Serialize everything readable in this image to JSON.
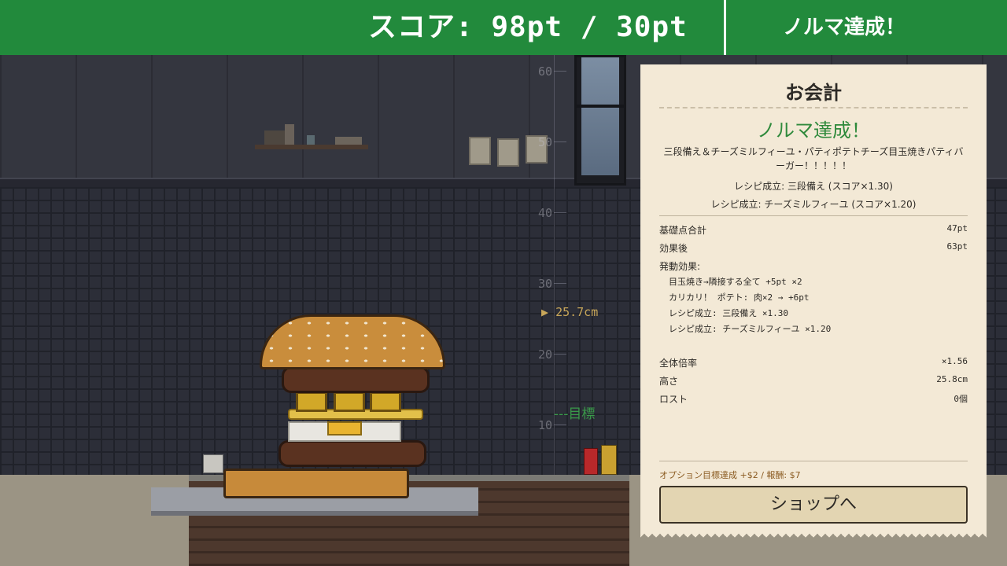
{
  "header": {
    "score_text": "スコア: 98pt / 30pt",
    "quota_status": "ノルマ達成！"
  },
  "scene": {
    "ruler_ticks": [
      "60",
      "50",
      "40",
      "30",
      "20",
      "10"
    ],
    "current_height": "25.7cm",
    "target_label": "目標"
  },
  "receipt": {
    "title": "お会計",
    "quota_status": "ノルマ達成！",
    "burger_name": "三段備え＆チーズミルフィーユ・パティポテトチーズ目玉焼きパティバーガー！！！！！",
    "recipes": [
      "レシピ成立: 三段備え (スコア×1.30)",
      "レシピ成立: チーズミルフィーユ (スコア×1.20)"
    ],
    "base_total_label": "基礎点合計",
    "base_total_value": "47pt",
    "after_effects_label": "効果後",
    "after_effects_value": "63pt",
    "effects_label": "発動効果:",
    "effects": [
      "目玉焼き→隣接する全て +5pt ×2",
      "カリカリ！ ポテト: 肉×2 → +6pt",
      "レシピ成立: 三段備え ×1.30",
      "レシピ成立: チーズミルフィーユ ×1.20"
    ],
    "multiplier_label": "全体倍率",
    "multiplier_value": "×1.56",
    "height_label": "高さ",
    "height_value": "25.8cm",
    "lost_label": "ロスト",
    "lost_value": "0個",
    "options_line": "オプション目標達成 +$2 / 報酬: $7",
    "shop_button": "ショップへ"
  },
  "colors": {
    "header_green": "#228a3c",
    "receipt_bg": "#f3e9d6",
    "quota_green": "#2f8a3c",
    "height_marker": "#c9a75a"
  }
}
